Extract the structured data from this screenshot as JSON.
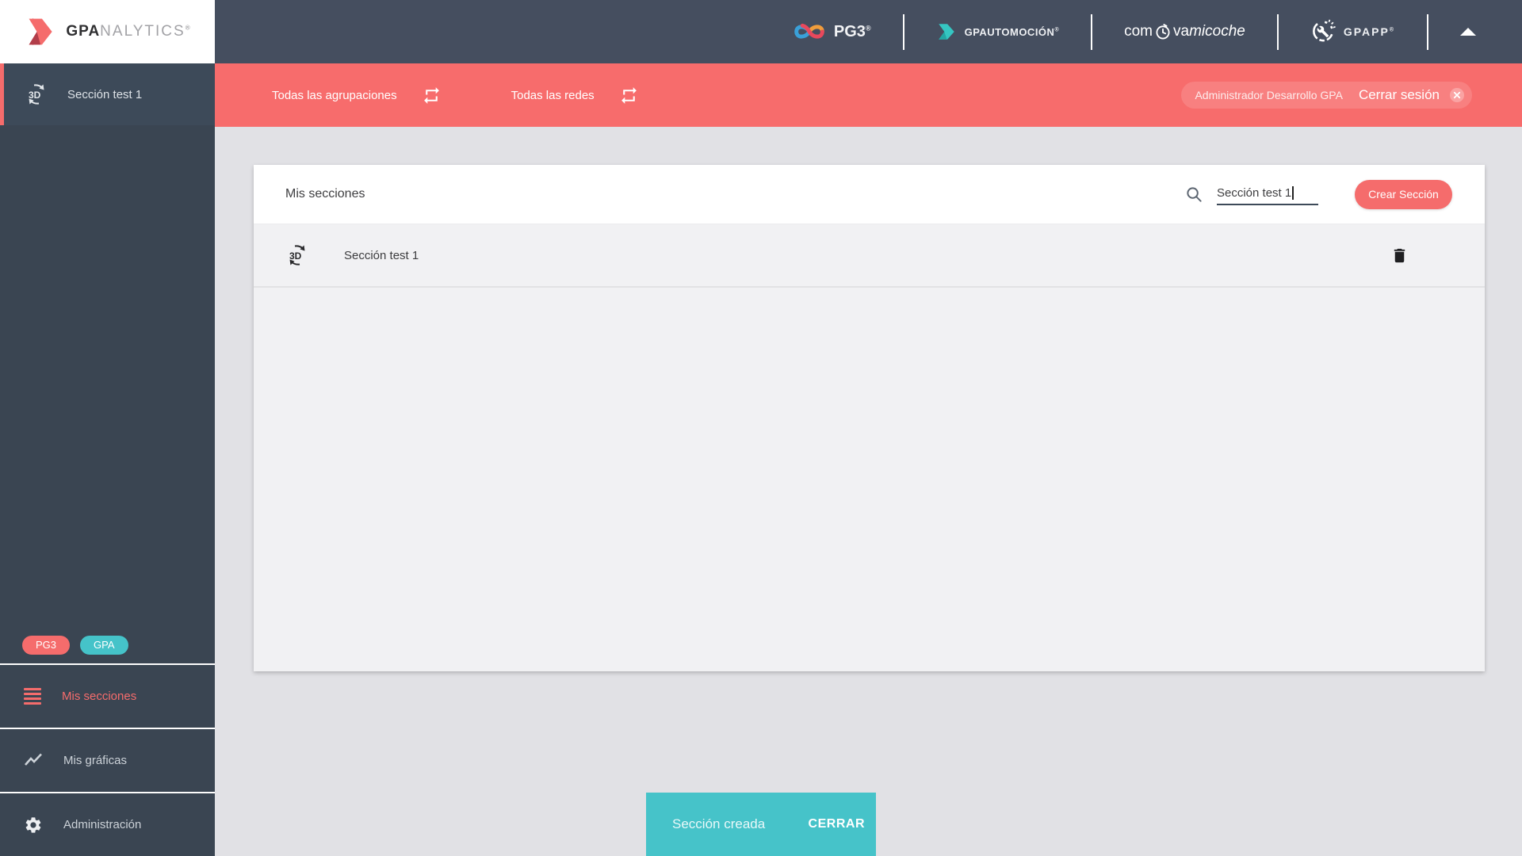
{
  "brand": {
    "bold": "GPA",
    "light": "NALYTICS",
    "reg": "®"
  },
  "sidebar": {
    "section_item": {
      "label": "Sección test 1"
    },
    "badges": [
      {
        "label": "PG3",
        "color": "#f56c6c"
      },
      {
        "label": "GPA",
        "color": "#45c3c9"
      }
    ],
    "menu": [
      {
        "label": "Mis secciones",
        "icon": "menu-icon",
        "active": true
      },
      {
        "label": "Mis gráficas",
        "icon": "line-chart-icon",
        "active": false
      },
      {
        "label": "Administración",
        "icon": "gear-icon",
        "active": false
      }
    ]
  },
  "header": {
    "logos": {
      "pg3": {
        "text": "PG3",
        "reg": "®"
      },
      "gpautomocion": {
        "text": "GPAUTOMOCIÓN",
        "reg": "®"
      },
      "comoravamicoche": {
        "part1": "com",
        "part2": "va",
        "part3": "micoche"
      },
      "gpapp": {
        "text": "GPAPP",
        "reg": "®"
      }
    }
  },
  "filter_bar": {
    "filters": [
      {
        "label": "Todas las agrupaciones",
        "icon": "repeat-icon"
      },
      {
        "label": "Todas las redes",
        "icon": "repeat-icon"
      }
    ],
    "user": {
      "name": "Administrador Desarrollo GPA",
      "logout_label": "Cerrar sesión"
    }
  },
  "main": {
    "card": {
      "title": "Mis secciones",
      "search": {
        "value": "Sección test 1"
      },
      "create_button_label": "Crear Sección",
      "rows": [
        {
          "label": "Sección test 1",
          "icon": "3d-rotation-icon"
        }
      ]
    }
  },
  "toast": {
    "message": "Sección creada",
    "action_label": "CERRAR"
  },
  "colors": {
    "accent": "#f56c6c",
    "teal": "#46c3c9",
    "topbar": "#454e5f",
    "sidebar": "#3a4552",
    "filter_bar": "#f76c6c"
  }
}
